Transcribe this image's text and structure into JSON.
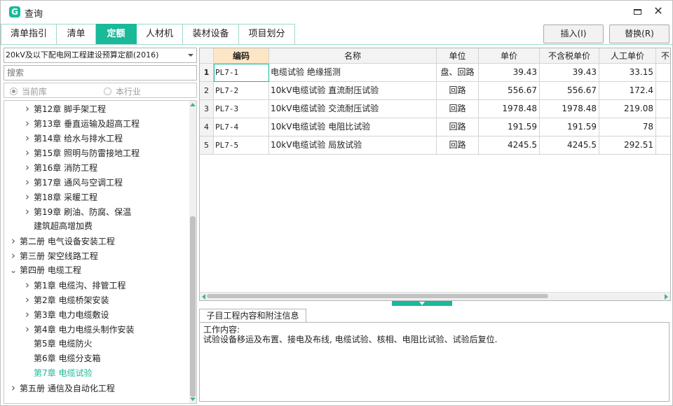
{
  "window": {
    "title": "查询",
    "app_icon_letter": "G"
  },
  "tabs": [
    {
      "label": "清单指引",
      "active": false
    },
    {
      "label": "清单",
      "active": false
    },
    {
      "label": "定额",
      "active": true
    },
    {
      "label": "人材机",
      "active": false
    },
    {
      "label": "装材设备",
      "active": false
    },
    {
      "label": "项目划分",
      "active": false
    }
  ],
  "actions": {
    "insert": "插入(I)",
    "replace": "替换(R)"
  },
  "left_panel": {
    "library_select": "20kV及以下配电网工程建设预算定额(2016)",
    "search_placeholder": "搜索",
    "scope_options": [
      {
        "label": "当前库",
        "selected": true
      },
      {
        "label": "本行业",
        "selected": false
      }
    ],
    "tree": [
      {
        "label": "第12章 脚手架工程",
        "level": 1,
        "expander": "collapsed"
      },
      {
        "label": "第13章 垂直运输及超高工程",
        "level": 1,
        "expander": "collapsed"
      },
      {
        "label": "第14章 给水与排水工程",
        "level": 1,
        "expander": "collapsed"
      },
      {
        "label": "第15章 照明与防雷接地工程",
        "level": 1,
        "expander": "collapsed"
      },
      {
        "label": "第16章 消防工程",
        "level": 1,
        "expander": "collapsed"
      },
      {
        "label": "第17章 通风与空调工程",
        "level": 1,
        "expander": "collapsed"
      },
      {
        "label": "第18章 采暖工程",
        "level": 1,
        "expander": "collapsed"
      },
      {
        "label": "第19章 刷油、防腐、保温",
        "level": 1,
        "expander": "collapsed"
      },
      {
        "label": "建筑超高增加费",
        "level": 1,
        "expander": "none"
      },
      {
        "label": "第二册 电气设备安装工程",
        "level": 0,
        "expander": "collapsed"
      },
      {
        "label": "第三册 架空线路工程",
        "level": 0,
        "expander": "collapsed"
      },
      {
        "label": "第四册 电缆工程",
        "level": 0,
        "expander": "expanded"
      },
      {
        "label": "第1章 电缆沟、排管工程",
        "level": 1,
        "expander": "collapsed"
      },
      {
        "label": "第2章 电缆桥架安装",
        "level": 1,
        "expander": "collapsed"
      },
      {
        "label": "第3章 电力电缆敷设",
        "level": 1,
        "expander": "collapsed"
      },
      {
        "label": "第4章 电力电缆头制作安装",
        "level": 1,
        "expander": "collapsed"
      },
      {
        "label": "第5章 电缆防火",
        "level": 1,
        "expander": "none"
      },
      {
        "label": "第6章 电缆分支箱",
        "level": 1,
        "expander": "none"
      },
      {
        "label": "第7章 电缆试验",
        "level": 1,
        "expander": "none",
        "selected": true
      },
      {
        "label": "第五册 通信及自动化工程",
        "level": 0,
        "expander": "collapsed"
      }
    ]
  },
  "grid": {
    "columns": [
      "编码",
      "名称",
      "单位",
      "单价",
      "不含税单价",
      "人工单价",
      "不含"
    ],
    "rows": [
      {
        "no": "1",
        "code": "PL7-1",
        "name": "电缆试验 绝缘摇测",
        "unit": "盘、回路",
        "price": "39.43",
        "price_ex_tax": "39.43",
        "labor": "33.15"
      },
      {
        "no": "2",
        "code": "PL7-2",
        "name": "10kV电缆试验 直流耐压试验",
        "unit": "回路",
        "price": "556.67",
        "price_ex_tax": "556.67",
        "labor": "172.4"
      },
      {
        "no": "3",
        "code": "PL7-3",
        "name": "10kV电缆试验 交流耐压试验",
        "unit": "回路",
        "price": "1978.48",
        "price_ex_tax": "1978.48",
        "labor": "219.08"
      },
      {
        "no": "4",
        "code": "PL7-4",
        "name": "10kV电缆试验 电阻比试验",
        "unit": "回路",
        "price": "191.59",
        "price_ex_tax": "191.59",
        "labor": "78"
      },
      {
        "no": "5",
        "code": "PL7-5",
        "name": "10kV电缆试验 局放试验",
        "unit": "回路",
        "price": "4245.5",
        "price_ex_tax": "4245.5",
        "labor": "292.51"
      }
    ]
  },
  "info_panel": {
    "tab_label": "子目工程内容和附注信息",
    "heading": "工作内容:",
    "content": "试验设备移运及布置、接电及布线, 电缆试验、核相、电阻比试验、试验后复位."
  },
  "colors": {
    "accent": "#19b99a",
    "header_highlight": "#fde6c6"
  }
}
